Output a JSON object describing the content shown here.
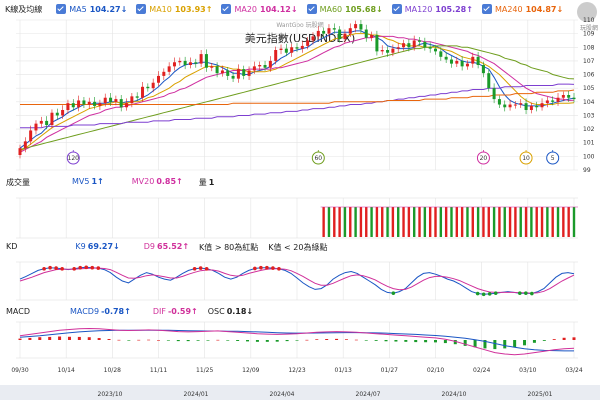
{
  "legend": {
    "title": "K線及均線",
    "items": [
      {
        "name": "MA5",
        "value": "104.27↓",
        "color": "#1a56c4"
      },
      {
        "name": "MA10",
        "value": "103.93↑",
        "color": "#d9a100"
      },
      {
        "name": "MA20",
        "value": "104.12↓",
        "color": "#cf2fa0"
      },
      {
        "name": "MA60",
        "value": "105.68↓",
        "color": "#6f9e1e"
      },
      {
        "name": "MA120",
        "value": "105.28↑",
        "color": "#7d3fd0"
      },
      {
        "name": "MA240",
        "value": "104.87↓",
        "color": "#e8650d"
      }
    ]
  },
  "watermark": "WantGoo 玩股網",
  "logo_text": "玩股網",
  "panels": {
    "volume": {
      "title": "成交量",
      "mv5_label": "MV5",
      "mv5_value": "1↑",
      "mv20_label": "MV20",
      "mv20_value": "0.85↑",
      "vol_label": "量",
      "vol_value": "1"
    },
    "kd": {
      "title": "KD",
      "k_label": "K9",
      "k_value": "69.27↓",
      "d_label": "D9",
      "d_value": "65.52↑",
      "note1": "K值 > 80為紅點",
      "note2": "K值 < 20為綠點"
    },
    "macd": {
      "title": "MACD",
      "macd_label": "MACD9",
      "macd_value": "-0.78↑",
      "dif_label": "DIF",
      "dif_value": "-0.59↑",
      "osc_label": "OSC",
      "osc_value": "0.18↓"
    }
  },
  "colors": {
    "up": "#e02020",
    "down": "#1a9a2a",
    "k": "#1a56c4",
    "d": "#d0309a",
    "grid": "#e4e4e4"
  },
  "chart_data": {
    "type": "candlestick",
    "title": "美元指數(USDINDEX)",
    "ylim": [
      99,
      110
    ],
    "yticks": [
      99,
      100,
      101,
      102,
      103,
      104,
      105,
      106,
      107,
      108,
      109,
      110
    ],
    "xticks": [
      "09/30",
      "10/14",
      "10/28",
      "11/11",
      "11/25",
      "12/09",
      "12/23",
      "01/13",
      "01/27",
      "02/10",
      "02/24",
      "03/10",
      "03/24"
    ],
    "period_ticks": [
      "2023/10",
      "2024/01",
      "2024/04",
      "2024/07",
      "2024/10",
      "2025/01"
    ],
    "close": [
      100.6,
      101.1,
      101.9,
      102.4,
      102.6,
      102.3,
      103.2,
      103.0,
      103.4,
      103.9,
      103.6,
      104.1,
      103.8,
      104.0,
      103.7,
      103.9,
      104.3,
      104.0,
      104.2,
      103.6,
      103.9,
      104.4,
      104.3,
      105.1,
      105.0,
      105.4,
      105.9,
      106.2,
      106.6,
      106.9,
      107.0,
      106.7,
      106.9,
      106.8,
      107.5,
      106.5,
      106.6,
      106.1,
      106.3,
      105.9,
      105.7,
      106.4,
      105.9,
      106.3,
      106.6,
      106.7,
      106.5,
      107.0,
      107.8,
      107.9,
      107.6,
      108.0,
      107.9,
      108.1,
      108.5,
      108.8,
      109.2,
      109.0,
      109.4,
      109.3,
      108.6,
      109.0,
      109.4,
      109.7,
      109.3,
      108.7,
      108.9,
      107.7,
      107.8,
      107.6,
      107.9,
      108.0,
      108.3,
      108.0,
      108.5,
      108.4,
      108.0,
      107.9,
      107.7,
      107.3,
      107.1,
      106.8,
      107.0,
      106.6,
      106.8,
      107.3,
      106.7,
      106.1,
      105.0,
      104.2,
      103.8,
      103.6,
      103.8,
      103.8,
      103.9,
      103.4,
      103.7,
      103.6,
      103.9,
      104.1,
      104.0,
      104.3,
      104.5,
      104.3,
      104.2
    ],
    "ma": {
      "MA5": [
        100.6,
        100.9,
        101.2,
        101.5,
        101.7,
        102.1,
        102.5,
        102.7,
        102.9,
        103.2,
        103.4,
        103.6,
        103.8,
        103.8,
        103.9,
        103.9,
        103.9,
        104.0,
        104.0,
        103.9,
        104.0,
        104.0,
        104.1,
        104.3,
        104.5,
        104.8,
        105.1,
        105.5,
        105.8,
        106.2,
        106.5,
        106.7,
        106.8,
        106.8,
        106.9,
        106.9,
        106.8,
        106.7,
        106.5,
        106.3,
        106.1,
        106.1,
        106.0,
        106.0,
        106.2,
        106.3,
        106.4,
        106.6,
        106.9,
        107.2,
        107.4,
        107.7,
        107.8,
        107.9,
        108.0,
        108.3,
        108.5,
        108.7,
        108.9,
        109.1,
        109.1,
        109.1,
        109.1,
        109.2,
        109.2,
        109.0,
        108.9,
        108.7,
        108.5,
        108.1,
        108.0,
        107.9,
        107.9,
        107.9,
        108.0,
        108.2,
        108.3,
        108.2,
        108.1,
        107.9,
        107.6,
        107.4,
        107.2,
        107.0,
        106.9,
        106.9,
        106.8,
        106.6,
        106.4,
        105.8,
        105.1,
        104.5,
        104.1,
        103.9,
        103.8,
        103.7,
        103.7,
        103.7,
        103.7,
        103.8,
        103.9,
        104.0,
        104.1,
        104.2,
        104.27
      ],
      "MA10": [
        100.4,
        100.6,
        100.9,
        101.2,
        101.5,
        101.8,
        102.1,
        102.3,
        102.5,
        102.7,
        102.9,
        103.1,
        103.3,
        103.5,
        103.6,
        103.7,
        103.8,
        103.9,
        104.0,
        103.9,
        103.9,
        104.0,
        104.0,
        104.1,
        104.3,
        104.4,
        104.6,
        104.8,
        105.0,
        105.3,
        105.5,
        105.8,
        106.0,
        106.2,
        106.4,
        106.6,
        106.6,
        106.6,
        106.6,
        106.5,
        106.4,
        106.4,
        106.3,
        106.2,
        106.2,
        106.2,
        106.2,
        106.3,
        106.4,
        106.6,
        106.8,
        107.0,
        107.2,
        107.4,
        107.6,
        107.8,
        108.0,
        108.2,
        108.4,
        108.6,
        108.7,
        108.8,
        108.9,
        109.0,
        109.0,
        109.0,
        108.9,
        108.9,
        108.8,
        108.6,
        108.5,
        108.3,
        108.2,
        108.1,
        108.1,
        108.1,
        108.0,
        108.0,
        108.0,
        107.9,
        107.8,
        107.7,
        107.5,
        107.3,
        107.2,
        107.1,
        107.0,
        106.8,
        106.6,
        106.3,
        106.0,
        105.6,
        105.2,
        104.8,
        104.4,
        104.1,
        103.9,
        103.8,
        103.8,
        103.8,
        103.8,
        103.9,
        103.9,
        103.9,
        103.93
      ],
      "MA20": [
        100.3,
        100.5,
        100.7,
        100.9,
        101.1,
        101.4,
        101.6,
        101.8,
        102.0,
        102.2,
        102.4,
        102.6,
        102.8,
        103.0,
        103.1,
        103.2,
        103.4,
        103.5,
        103.6,
        103.6,
        103.7,
        103.8,
        103.9,
        104.0,
        104.1,
        104.2,
        104.3,
        104.4,
        104.6,
        104.7,
        104.9,
        105.0,
        105.2,
        105.4,
        105.6,
        105.8,
        105.9,
        106.0,
        106.1,
        106.2,
        106.3,
        106.3,
        106.3,
        106.4,
        106.4,
        106.4,
        106.4,
        106.4,
        106.5,
        106.5,
        106.6,
        106.7,
        106.8,
        106.9,
        107.0,
        107.2,
        107.4,
        107.6,
        107.8,
        108.0,
        108.1,
        108.3,
        108.4,
        108.5,
        108.6,
        108.7,
        108.7,
        108.8,
        108.8,
        108.8,
        108.8,
        108.7,
        108.7,
        108.6,
        108.6,
        108.5,
        108.4,
        108.4,
        108.3,
        108.2,
        108.1,
        108.0,
        107.9,
        107.8,
        107.7,
        107.5,
        107.4,
        107.2,
        107.0,
        106.8,
        106.5,
        106.2,
        105.9,
        105.6,
        105.3,
        105.0,
        104.8,
        104.6,
        104.5,
        104.4,
        104.3,
        104.2,
        104.2,
        104.1,
        104.12
      ],
      "MA60": [
        100.5,
        100.6,
        100.7,
        100.8,
        100.9,
        101.0,
        101.1,
        101.2,
        101.3,
        101.4,
        101.5,
        101.6,
        101.7,
        101.8,
        101.9,
        102.0,
        102.1,
        102.2,
        102.3,
        102.4,
        102.5,
        102.6,
        102.7,
        102.8,
        102.9,
        103.0,
        103.1,
        103.2,
        103.3,
        103.4,
        103.5,
        103.6,
        103.7,
        103.8,
        103.9,
        104.0,
        104.1,
        104.2,
        104.3,
        104.4,
        104.5,
        104.6,
        104.7,
        104.8,
        104.9,
        105.0,
        105.1,
        105.2,
        105.3,
        105.4,
        105.5,
        105.6,
        105.7,
        105.8,
        105.9,
        106.0,
        106.1,
        106.2,
        106.3,
        106.4,
        106.5,
        106.6,
        106.7,
        106.8,
        106.9,
        107.0,
        107.1,
        107.2,
        107.3,
        107.4,
        107.5,
        107.6,
        107.7,
        107.8,
        107.9,
        107.9,
        108.0,
        108.0,
        108.1,
        108.1,
        108.1,
        108.1,
        108.1,
        108.0,
        108.0,
        107.9,
        107.8,
        107.7,
        107.6,
        107.5,
        107.4,
        107.2,
        107.1,
        107.0,
        106.8,
        106.7,
        106.5,
        106.4,
        106.3,
        106.2,
        106.0,
        105.9,
        105.8,
        105.7,
        105.68
      ],
      "MA120": [
        102.1,
        102.1,
        102.1,
        102.1,
        102.1,
        102.2,
        102.2,
        102.2,
        102.2,
        102.2,
        102.3,
        102.3,
        102.3,
        102.3,
        102.3,
        102.4,
        102.4,
        102.4,
        102.4,
        102.4,
        102.5,
        102.5,
        102.5,
        102.5,
        102.5,
        102.6,
        102.6,
        102.6,
        102.6,
        102.7,
        102.7,
        102.7,
        102.7,
        102.8,
        102.8,
        102.8,
        102.8,
        102.9,
        102.9,
        102.9,
        102.9,
        103.0,
        103.0,
        103.0,
        103.1,
        103.1,
        103.1,
        103.2,
        103.2,
        103.2,
        103.3,
        103.3,
        103.3,
        103.4,
        103.4,
        103.5,
        103.5,
        103.5,
        103.6,
        103.6,
        103.7,
        103.7,
        103.8,
        103.8,
        103.8,
        103.9,
        103.9,
        104.0,
        104.0,
        104.1,
        104.1,
        104.2,
        104.2,
        104.3,
        104.3,
        104.4,
        104.4,
        104.5,
        104.5,
        104.6,
        104.6,
        104.7,
        104.7,
        104.8,
        104.8,
        104.9,
        104.9,
        104.9,
        105.0,
        105.0,
        105.0,
        105.1,
        105.1,
        105.1,
        105.1,
        105.2,
        105.2,
        105.2,
        105.2,
        105.2,
        105.2,
        105.3,
        105.3,
        105.3,
        105.28
      ],
      "MA240": [
        103.8,
        103.8,
        103.8,
        103.8,
        103.8,
        103.8,
        103.8,
        103.8,
        103.8,
        103.8,
        103.8,
        103.8,
        103.8,
        103.8,
        103.8,
        103.8,
        103.8,
        103.8,
        103.8,
        103.8,
        103.8,
        103.8,
        103.8,
        103.8,
        103.8,
        103.8,
        103.8,
        103.8,
        103.8,
        103.8,
        103.8,
        103.8,
        103.8,
        103.8,
        103.8,
        103.8,
        103.8,
        103.8,
        103.8,
        103.8,
        103.9,
        103.9,
        103.9,
        103.9,
        103.9,
        103.9,
        103.9,
        103.9,
        103.9,
        103.9,
        103.9,
        103.9,
        103.9,
        103.9,
        103.9,
        103.9,
        103.9,
        103.9,
        103.9,
        104.0,
        104.0,
        104.0,
        104.0,
        104.0,
        104.0,
        104.0,
        104.0,
        104.0,
        104.0,
        104.1,
        104.1,
        104.1,
        104.1,
        104.1,
        104.1,
        104.1,
        104.2,
        104.2,
        104.2,
        104.2,
        104.2,
        104.3,
        104.3,
        104.3,
        104.3,
        104.4,
        104.4,
        104.4,
        104.4,
        104.5,
        104.5,
        104.5,
        104.5,
        104.6,
        104.6,
        104.6,
        104.6,
        104.7,
        104.7,
        104.7,
        104.7,
        104.8,
        104.8,
        104.8,
        104.87
      ]
    },
    "markers": [
      {
        "label": "120",
        "index": 10,
        "color": "#7d3fd0"
      },
      {
        "label": "60",
        "index": 56,
        "color": "#6f9e1e"
      },
      {
        "label": "20",
        "index": 87,
        "color": "#cf2fa0"
      },
      {
        "label": "10",
        "index": 95,
        "color": "#d9a100"
      },
      {
        "label": "5",
        "index": 100,
        "color": "#1a56c4"
      }
    ],
    "volume_start_index": 57,
    "volume_pattern": [
      1,
      0,
      1,
      1,
      0,
      1,
      0,
      1,
      1,
      0,
      1,
      1,
      0,
      1,
      0,
      1,
      1,
      0,
      1,
      0,
      1,
      1,
      0,
      1,
      0,
      1,
      1,
      0,
      1,
      0,
      1,
      1,
      0,
      1,
      0,
      1,
      1,
      0,
      1,
      0,
      1,
      1,
      0,
      1,
      0,
      1,
      1,
      0
    ],
    "kd": {
      "K": [
        55,
        62,
        70,
        78,
        82,
        85,
        84,
        82,
        80,
        82,
        85,
        86,
        85,
        84,
        80,
        72,
        60,
        50,
        45,
        55,
        65,
        72,
        68,
        60,
        55,
        52,
        60,
        70,
        78,
        82,
        84,
        82,
        78,
        70,
        60,
        55,
        60,
        70,
        78,
        83,
        85,
        85,
        84,
        82,
        78,
        70,
        58,
        45,
        35,
        28,
        30,
        40,
        55,
        65,
        72,
        75,
        70,
        60,
        50,
        40,
        28,
        20,
        18,
        22,
        30,
        45,
        60,
        70,
        72,
        68,
        62,
        55,
        50,
        42,
        32,
        22,
        17,
        15,
        16,
        18,
        20,
        22,
        20,
        18,
        18,
        17,
        22,
        30,
        45,
        60,
        70,
        72,
        69.27
      ],
      "D": [
        50,
        55,
        60,
        66,
        72,
        76,
        80,
        81,
        81,
        81,
        82,
        83,
        84,
        84,
        83,
        80,
        73,
        65,
        58,
        57,
        60,
        64,
        66,
        64,
        61,
        58,
        58,
        62,
        68,
        73,
        77,
        79,
        79,
        76,
        70,
        65,
        63,
        65,
        70,
        74,
        78,
        81,
        82,
        82,
        81,
        77,
        70,
        62,
        53,
        44,
        39,
        39,
        44,
        51,
        58,
        64,
        66,
        64,
        59,
        53,
        44,
        36,
        30,
        27,
        28,
        34,
        43,
        52,
        59,
        62,
        62,
        60,
        56,
        51,
        44,
        37,
        30,
        25,
        21,
        20,
        20,
        20,
        20,
        19,
        19,
        18,
        19,
        23,
        30,
        40,
        50,
        58,
        65.52
      ]
    },
    "macd": {
      "DIF": [
        0.3,
        0.4,
        0.5,
        0.6,
        0.7,
        0.75,
        0.8,
        0.82,
        0.8,
        0.75,
        0.7,
        0.68,
        0.7,
        0.72,
        0.7,
        0.65,
        0.6,
        0.58,
        0.6,
        0.62,
        0.65,
        0.6,
        0.55,
        0.5,
        0.45,
        0.42,
        0.4,
        0.42,
        0.45,
        0.5,
        0.55,
        0.58,
        0.6,
        0.58,
        0.55,
        0.5,
        0.45,
        0.4,
        0.35,
        0.3,
        0.25,
        0.2,
        0.15,
        0.05,
        -0.1,
        -0.3,
        -0.5,
        -0.7,
        -0.9,
        -1.0,
        -1.05,
        -1.0,
        -0.9,
        -0.8,
        -0.7,
        -0.62,
        -0.59
      ],
      "MACD": [
        0.2,
        0.25,
        0.3,
        0.38,
        0.45,
        0.52,
        0.58,
        0.62,
        0.66,
        0.68,
        0.69,
        0.69,
        0.69,
        0.7,
        0.7,
        0.69,
        0.68,
        0.66,
        0.65,
        0.64,
        0.64,
        0.63,
        0.62,
        0.6,
        0.58,
        0.55,
        0.52,
        0.5,
        0.49,
        0.49,
        0.5,
        0.51,
        0.52,
        0.53,
        0.53,
        0.52,
        0.51,
        0.49,
        0.46,
        0.43,
        0.4,
        0.36,
        0.32,
        0.27,
        0.2,
        0.12,
        0.02,
        -0.1,
        -0.25,
        -0.4,
        -0.52,
        -0.62,
        -0.7,
        -0.74,
        -0.76,
        -0.78,
        -0.78
      ]
    }
  }
}
